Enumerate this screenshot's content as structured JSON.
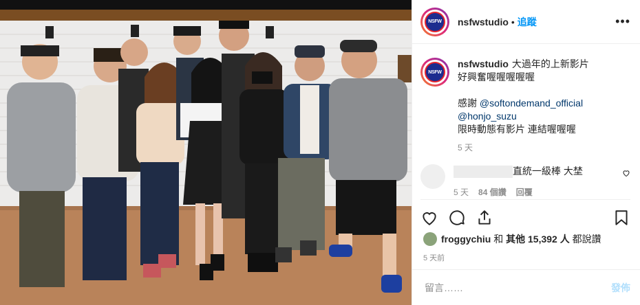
{
  "post": {
    "username": "nsfwstudio",
    "follow_label": "追蹤",
    "more_label": "•••",
    "logo_text": "NSFW",
    "caption": {
      "username": "nsfwstudio",
      "line1": "大過年的上新影片",
      "line2": "好興奮喔喔喔喔喔",
      "thanks": "感謝",
      "tag1": "@softondemand_official",
      "tag2": "@honjo_suzu",
      "line3": "限時動態有影片 連結喔喔喔",
      "time": "5 天"
    },
    "comment": {
      "text": "直統一級棒 大埜",
      "time": "5 天",
      "likes": "84 個讚",
      "reply": "回覆"
    },
    "likes": {
      "user": "froggychiu",
      "and": "和",
      "others": "其他 15,392 人",
      "suffix": "都說讚"
    },
    "date": "5 天前",
    "add_comment_placeholder": "留言……",
    "post_label": "發佈"
  },
  "colors": {
    "accent": "#0095f6",
    "post_disabled": "#b2dffc",
    "muted": "#8e8e8e"
  },
  "icons": [
    "more-icon",
    "heart-icon",
    "comment-icon",
    "share-icon",
    "save-icon",
    "small-heart-icon"
  ]
}
